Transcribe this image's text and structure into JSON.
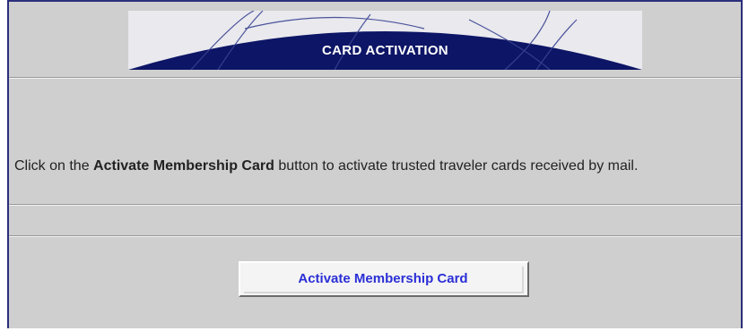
{
  "banner": {
    "title": "CARD ACTIVATION"
  },
  "intro": {
    "prefix": "Click on the ",
    "emphasis": "Activate Membership Card",
    "suffix": " button to activate trusted traveler cards received by mail."
  },
  "actions": {
    "activate_label": "Activate Membership Card"
  },
  "colors": {
    "banner_navy": "#0d1566",
    "panel_gray": "#cfcfcf",
    "button_text": "#2b2fd6",
    "frame_border": "#2b2f7a"
  }
}
